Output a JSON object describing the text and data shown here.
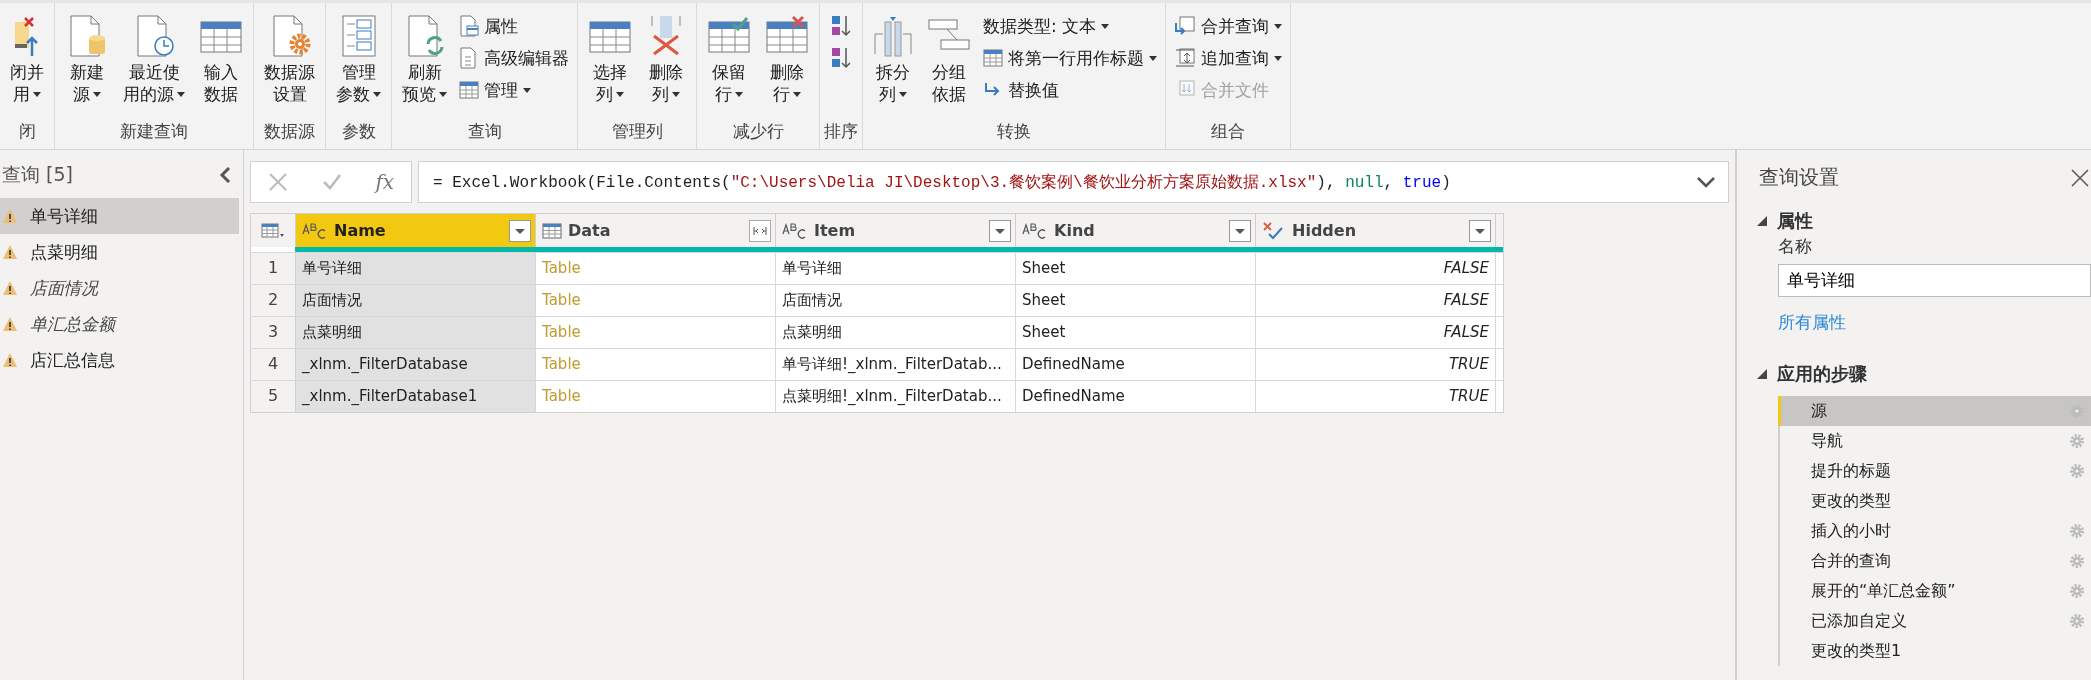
{
  "ribbon": {
    "groups": [
      {
        "label": "闭",
        "large": [
          {
            "lines": [
              "闭并",
              "用"
            ],
            "dropdown": true
          }
        ]
      },
      {
        "label": "新建查询",
        "large": [
          {
            "lines": [
              "新建",
              "源"
            ],
            "dropdown": true
          },
          {
            "lines": [
              "最近使",
              "用的源"
            ],
            "dropdown": true
          },
          {
            "lines": [
              "输入",
              "数据"
            ],
            "dropdown": false
          }
        ]
      },
      {
        "label": "数据源",
        "large": [
          {
            "lines": [
              "数据源",
              "设置"
            ],
            "dropdown": false
          }
        ]
      },
      {
        "label": "参数",
        "large": [
          {
            "lines": [
              "管理",
              "参数"
            ],
            "dropdown": true
          }
        ]
      },
      {
        "label": "查询",
        "large": [
          {
            "lines": [
              "刷新",
              "预览"
            ],
            "dropdown": true
          }
        ],
        "small": [
          {
            "label": "属性",
            "dropdown": false,
            "disabled": false
          },
          {
            "label": "高级编辑器",
            "dropdown": false,
            "disabled": false
          },
          {
            "label": "管理",
            "dropdown": true,
            "disabled": false
          }
        ]
      },
      {
        "label": "管理列",
        "large": [
          {
            "lines": [
              "选择",
              "列"
            ],
            "dropdown": true
          },
          {
            "lines": [
              "删除",
              "列"
            ],
            "dropdown": true
          }
        ]
      },
      {
        "label": "减少行",
        "large": [
          {
            "lines": [
              "保留",
              "行"
            ],
            "dropdown": true
          },
          {
            "lines": [
              "删除",
              "行"
            ],
            "dropdown": true
          }
        ]
      },
      {
        "label": "排序",
        "small": [
          {
            "dropdown": false,
            "disabled": false
          },
          {
            "dropdown": false,
            "disabled": false
          }
        ]
      },
      {
        "label": "转换",
        "large": [
          {
            "lines": [
              "拆分",
              "列"
            ],
            "dropdown": true
          },
          {
            "lines": [
              "分组",
              "依据"
            ],
            "dropdown": false
          }
        ],
        "small": [
          {
            "label": "数据类型: 文本",
            "dropdown": true,
            "disabled": false
          },
          {
            "label": "将第一行用作标题",
            "dropdown": true,
            "disabled": false
          },
          {
            "label": "替换值",
            "dropdown": false,
            "disabled": false
          }
        ]
      },
      {
        "label": "组合",
        "small": [
          {
            "label": "合并查询",
            "dropdown": true,
            "disabled": false
          },
          {
            "label": "追加查询",
            "dropdown": true,
            "disabled": false
          },
          {
            "label": "合并文件",
            "dropdown": false,
            "disabled": true
          }
        ]
      }
    ]
  },
  "queries": {
    "title": "查询 [5]",
    "items": [
      {
        "name": "单号详细",
        "selected": true,
        "load_enabled": true
      },
      {
        "name": "点菜明细",
        "selected": false,
        "load_enabled": true
      },
      {
        "name": "店面情况",
        "selected": false,
        "load_enabled": false
      },
      {
        "name": "单汇总金额",
        "selected": false,
        "load_enabled": false
      },
      {
        "name": "店汇总信息",
        "selected": false,
        "load_enabled": true
      }
    ]
  },
  "formula_bar": {
    "fx": "fx",
    "segments": [
      {
        "text": "= Excel.Workbook(File.Contents(",
        "kind": "plain"
      },
      {
        "text": "\"C:\\Users\\Delia JI\\Desktop\\3.餐饮案例\\餐饮业分析方案原始数据.xlsx\"",
        "kind": "string"
      },
      {
        "text": "), ",
        "kind": "plain"
      },
      {
        "text": "null",
        "kind": "literal"
      },
      {
        "text": ", ",
        "kind": "plain"
      },
      {
        "text": "true",
        "kind": "keyword"
      },
      {
        "text": ")",
        "kind": "plain"
      }
    ]
  },
  "table": {
    "columns": [
      {
        "name": "Name",
        "kind": "text",
        "selected": true
      },
      {
        "name": "Data",
        "kind": "table",
        "selected": false
      },
      {
        "name": "Item",
        "kind": "text",
        "selected": false
      },
      {
        "name": "Kind",
        "kind": "text",
        "selected": false
      },
      {
        "name": "Hidden",
        "kind": "logical",
        "selected": false
      }
    ],
    "rows": [
      {
        "index": "1",
        "cells": [
          "单号详细",
          "Table",
          "单号详细",
          "Sheet",
          "FALSE"
        ]
      },
      {
        "index": "2",
        "cells": [
          "店面情况",
          "Table",
          "店面情况",
          "Sheet",
          "FALSE"
        ]
      },
      {
        "index": "3",
        "cells": [
          "点菜明细",
          "Table",
          "点菜明细",
          "Sheet",
          "FALSE"
        ]
      },
      {
        "index": "4",
        "cells": [
          "_xlnm._FilterDatabase",
          "Table",
          "单号详细!_xlnm._FilterDatab...",
          "DefinedName",
          "TRUE"
        ]
      },
      {
        "index": "5",
        "cells": [
          "_xlnm._FilterDatabase1",
          "Table",
          "点菜明细!_xlnm._FilterDatab...",
          "DefinedName",
          "TRUE"
        ]
      }
    ]
  },
  "settings": {
    "title": "查询设置",
    "properties": {
      "heading": "属性",
      "name_label": "名称",
      "name_value": "单号详细",
      "all_properties_link": "所有属性"
    },
    "steps": {
      "heading": "应用的步骤",
      "items": [
        {
          "name": "源",
          "selected": true,
          "has_settings": true
        },
        {
          "name": "导航",
          "selected": false,
          "has_settings": true
        },
        {
          "name": "提升的标题",
          "selected": false,
          "has_settings": true
        },
        {
          "name": "更改的类型",
          "selected": false,
          "has_settings": false
        },
        {
          "name": "插入的小时",
          "selected": false,
          "has_settings": true
        },
        {
          "name": "合并的查询",
          "selected": false,
          "has_settings": true
        },
        {
          "name": "展开的“单汇总金额”",
          "selected": false,
          "has_settings": true
        },
        {
          "name": "已添加自定义",
          "selected": false,
          "has_settings": true
        },
        {
          "name": "更改的类型1",
          "selected": false,
          "has_settings": false
        }
      ]
    }
  }
}
